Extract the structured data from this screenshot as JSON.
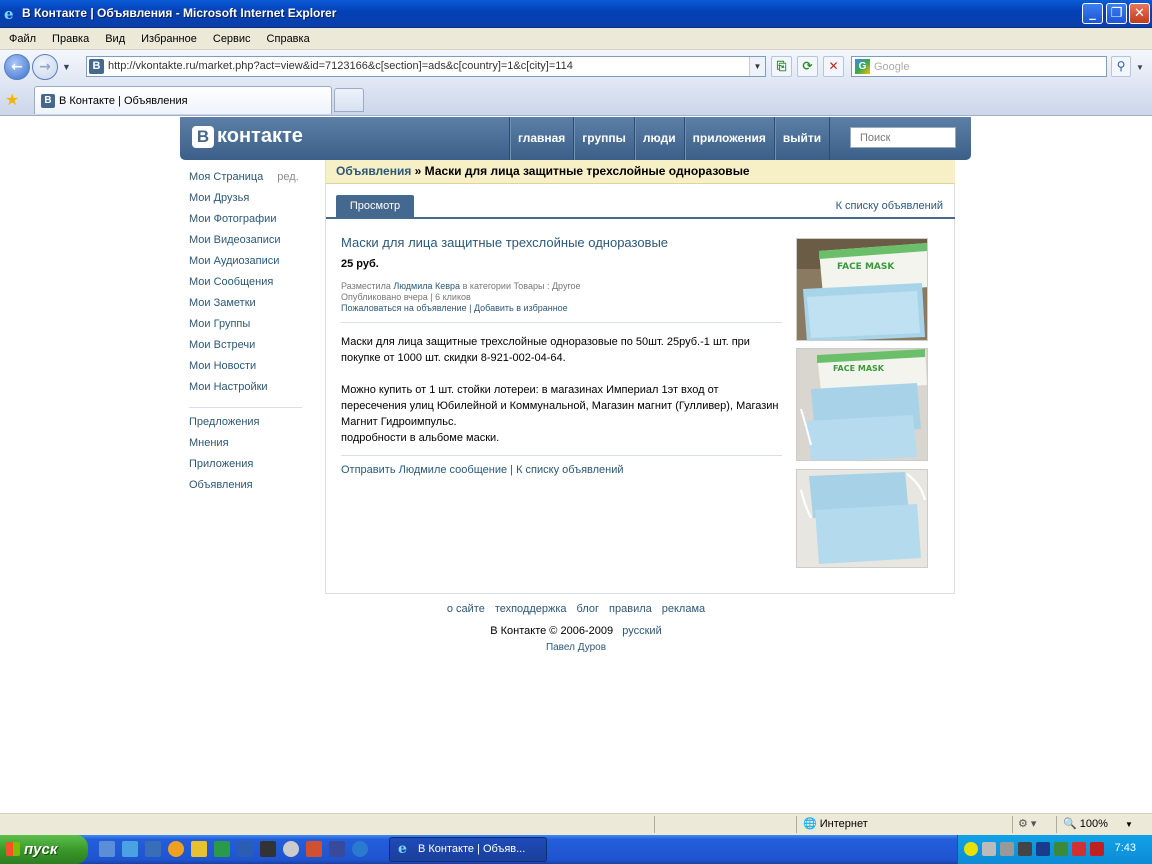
{
  "window": {
    "title": "В Контакте | Объявления - Microsoft Internet Explorer"
  },
  "menu": [
    "Файл",
    "Правка",
    "Вид",
    "Избранное",
    "Сервис",
    "Справка"
  ],
  "address": {
    "url": "http://vkontakte.ru/market.php?act=view&id=7123166&c[section]=ads&c[country]=1&c[city]=114"
  },
  "search": {
    "placeholder": "Google"
  },
  "tab": {
    "label": "В Контакте | Объявления"
  },
  "vk": {
    "logo_letter": "В",
    "logo_text": "контакте",
    "nav": [
      "главная",
      "группы",
      "люди",
      "приложения",
      "выйти"
    ],
    "search_placeholder": "Поиск"
  },
  "leftmenu": {
    "top": [
      {
        "label": "Моя Страница",
        "edit": "ред."
      },
      {
        "label": "Мои Друзья"
      },
      {
        "label": "Мои Фотографии"
      },
      {
        "label": "Мои Видеозаписи"
      },
      {
        "label": "Мои Аудиозаписи"
      },
      {
        "label": "Мои Сообщения"
      },
      {
        "label": "Мои Заметки"
      },
      {
        "label": "Мои Группы"
      },
      {
        "label": "Мои Встречи"
      },
      {
        "label": "Мои Новости"
      },
      {
        "label": "Мои Настройки"
      }
    ],
    "bottom": [
      "Предложения",
      "Мнения",
      "Приложения",
      "Объявления"
    ]
  },
  "ad": {
    "breadcrumb_link": "Объявления",
    "breadcrumb_sep": " » ",
    "breadcrumb_current": "Маски для лица защитные трехслойные одноразовые",
    "tab_label": "Просмотр",
    "back_link": "К списку объявлений",
    "title": "Маски для лица защитные трехслойные одноразовые",
    "price": "25 руб.",
    "posted_by_prefix": "Разместила ",
    "author": "Людмила Кевра",
    "category_prefix": " в категории ",
    "category": "Товары : Другое",
    "published": "Опубликовано вчера",
    "clicks": "6 кликов",
    "report_link": "Пожаловаться на объявление",
    "favorite_link": "Добавить в избранное",
    "description_1": "Маски для лица защитные трехслойные одноразовые по 50шт. 25руб.-1 шт. при покупке от 1000 шт. скидки 8-921-002-04-64.",
    "description_2": "Можно купить от 1 шт. стойки лотереи: в магазинах Империал 1эт вход от пересечения улиц Юбилейной и Коммунальной, Магазин магнит (Гулливер), Магазин Магнит Гидроимпульс.",
    "description_3": "подробности в альбоме маски.",
    "send_message_link": "Отправить Людмиле сообщение",
    "list_link": "К списку объявлений",
    "photo_box_text": "FACE MASK"
  },
  "footer": {
    "links": [
      "о сайте",
      "техподдержка",
      "блог",
      "правила",
      "реклама"
    ],
    "copyright": "В Контакте © 2006-2009",
    "language": "русский",
    "author": "Павел Дуров"
  },
  "status": {
    "zone": "Интернет",
    "zoom": "100%"
  },
  "taskbar": {
    "start": "пуск",
    "item": "В Контакте | Объяв...",
    "clock": "7:43"
  }
}
